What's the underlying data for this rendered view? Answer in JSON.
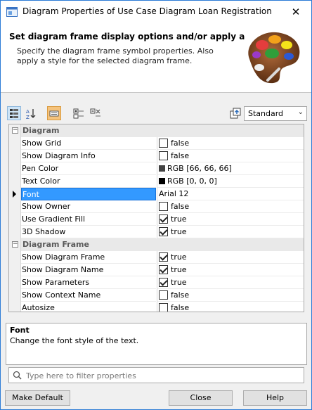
{
  "window": {
    "title": "Diagram Properties of Use Case Diagram Loan Registration",
    "close_glyph": "✕"
  },
  "header": {
    "title": "Set diagram frame display options and/or apply a",
    "description": "Specify the diagram frame symbol properties. Also apply a style for the selected diagram frame.",
    "image_icon": "palette-icon"
  },
  "toolbar": {
    "buttons": [
      {
        "name": "categorized-view-icon"
      },
      {
        "name": "sort-alphabetical-icon"
      },
      {
        "name": "standard-mode-icon"
      },
      {
        "name": "expand-all-icon"
      },
      {
        "name": "collapse-all-icon"
      },
      {
        "name": "apply-style-icon"
      }
    ],
    "style_select": {
      "value": "Standard"
    }
  },
  "properties": {
    "groups": [
      {
        "label": "Diagram",
        "expander": "−",
        "rows": [
          {
            "name": "Show Grid",
            "type": "checkbox",
            "checked": false,
            "value": "false"
          },
          {
            "name": "Show Diagram Info",
            "type": "checkbox",
            "checked": false,
            "value": "false"
          },
          {
            "name": "Pen Color",
            "type": "color",
            "color": "#424242",
            "value": "RGB [66, 66, 66]"
          },
          {
            "name": "Text Color",
            "type": "color",
            "color": "#000000",
            "value": "RGB [0, 0, 0]"
          },
          {
            "name": "Font",
            "type": "text",
            "value": "Arial 12",
            "selected": true
          },
          {
            "name": "Show Owner",
            "type": "checkbox",
            "checked": false,
            "value": "false"
          },
          {
            "name": "Use Gradient Fill",
            "type": "checkbox",
            "checked": true,
            "value": "true"
          },
          {
            "name": "3D Shadow",
            "type": "checkbox",
            "checked": true,
            "value": "true"
          }
        ]
      },
      {
        "label": "Diagram Frame",
        "expander": "−",
        "rows": [
          {
            "name": "Show Diagram Frame",
            "type": "checkbox",
            "checked": true,
            "value": "true"
          },
          {
            "name": "Show Diagram Name",
            "type": "checkbox",
            "checked": true,
            "value": "true"
          },
          {
            "name": "Show Parameters",
            "type": "checkbox",
            "checked": true,
            "value": "true"
          },
          {
            "name": "Show Context Name",
            "type": "checkbox",
            "checked": false,
            "value": "false"
          },
          {
            "name": "Autosize",
            "type": "checkbox",
            "checked": false,
            "value": "false"
          }
        ]
      }
    ]
  },
  "description_box": {
    "title": "Font",
    "text": "Change the font style of the text."
  },
  "filter": {
    "placeholder": "Type here to filter properties"
  },
  "buttons": {
    "make_default": "Make Default",
    "close": "Close",
    "help": "Help"
  },
  "colors": {
    "selection": "#3399ff",
    "window_border": "#2b7bd6"
  }
}
